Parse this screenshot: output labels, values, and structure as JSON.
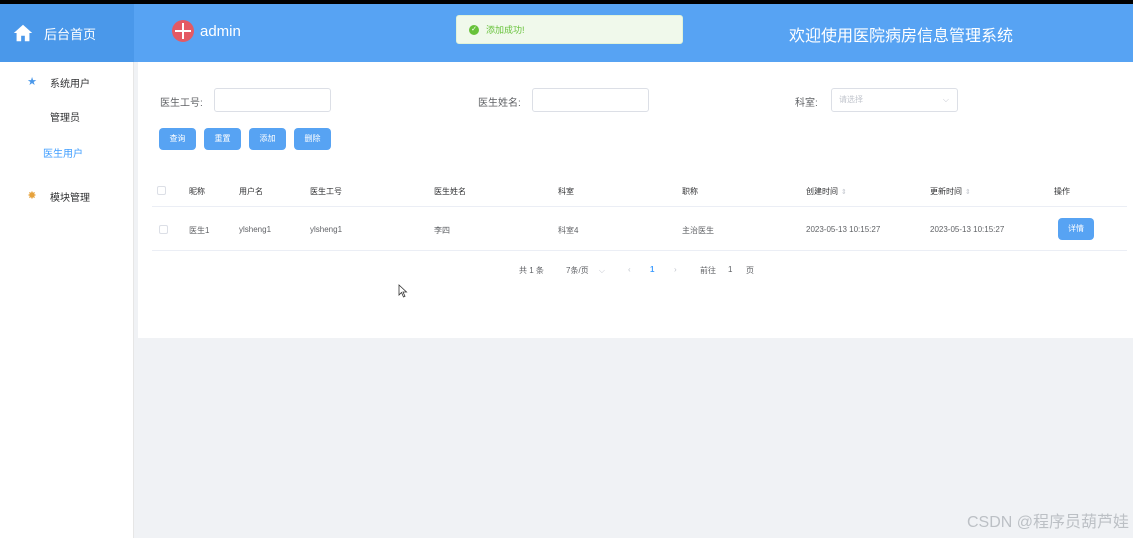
{
  "header": {
    "home_label": "后台首页",
    "username": "admin",
    "site_title": "欢迎使用医院病房信息管理系统",
    "toast": "添加成功!"
  },
  "sidebar": {
    "items": [
      {
        "label": "系统用户",
        "icon": "star-icon"
      },
      {
        "label": "管理员"
      },
      {
        "label": "医生用户"
      },
      {
        "label": "模块管理",
        "icon": "gear-icon"
      }
    ]
  },
  "search": {
    "doctor_no_label": "医生工号:",
    "doctor_name_label": "医生姓名:",
    "dept_label": "科室:",
    "dept_placeholder": "请选择"
  },
  "buttons": {
    "query": "查询",
    "reset": "重置",
    "add": "添加",
    "delete": "删除",
    "detail": "详情"
  },
  "table": {
    "headers": [
      "昵称",
      "用户名",
      "医生工号",
      "医生姓名",
      "科室",
      "职称",
      "创建时间",
      "更新时间",
      "操作"
    ],
    "rows": [
      [
        "医生1",
        "ylsheng1",
        "ylsheng1",
        "李四",
        "科室4",
        "主治医生",
        "2023-05-13 10:15:27",
        "2023-05-13 10:15:27"
      ]
    ]
  },
  "pagination": {
    "total": "共 1 条",
    "page_size": "7条/页",
    "current": "1",
    "goto_label": "前往",
    "goto_value": "1",
    "page_unit": "页"
  },
  "watermark": "CSDN @程序员葫芦娃",
  "colors": {
    "primary": "#57a3f3",
    "accent": "#409eff",
    "success": "#67c23a"
  }
}
